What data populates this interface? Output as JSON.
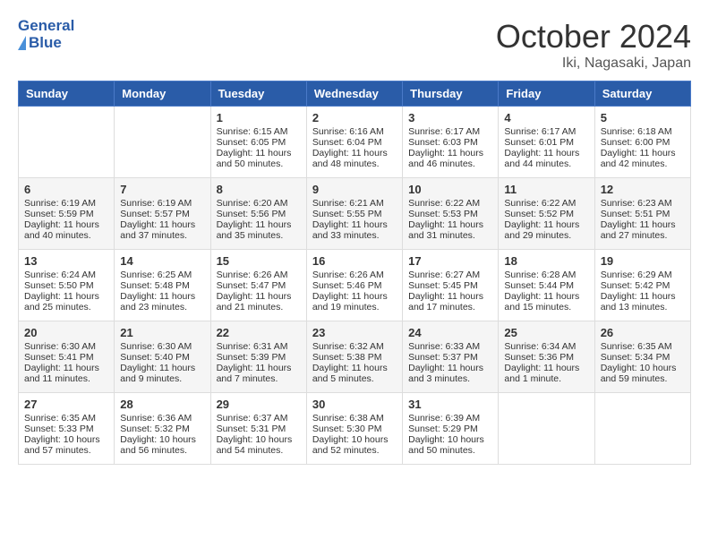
{
  "header": {
    "logo_general": "General",
    "logo_blue": "Blue",
    "month": "October 2024",
    "location": "Iki, Nagasaki, Japan"
  },
  "weekdays": [
    "Sunday",
    "Monday",
    "Tuesday",
    "Wednesday",
    "Thursday",
    "Friday",
    "Saturday"
  ],
  "weeks": [
    [
      {
        "day": "",
        "sunrise": "",
        "sunset": "",
        "daylight": ""
      },
      {
        "day": "",
        "sunrise": "",
        "sunset": "",
        "daylight": ""
      },
      {
        "day": "1",
        "sunrise": "Sunrise: 6:15 AM",
        "sunset": "Sunset: 6:05 PM",
        "daylight": "Daylight: 11 hours and 50 minutes."
      },
      {
        "day": "2",
        "sunrise": "Sunrise: 6:16 AM",
        "sunset": "Sunset: 6:04 PM",
        "daylight": "Daylight: 11 hours and 48 minutes."
      },
      {
        "day": "3",
        "sunrise": "Sunrise: 6:17 AM",
        "sunset": "Sunset: 6:03 PM",
        "daylight": "Daylight: 11 hours and 46 minutes."
      },
      {
        "day": "4",
        "sunrise": "Sunrise: 6:17 AM",
        "sunset": "Sunset: 6:01 PM",
        "daylight": "Daylight: 11 hours and 44 minutes."
      },
      {
        "day": "5",
        "sunrise": "Sunrise: 6:18 AM",
        "sunset": "Sunset: 6:00 PM",
        "daylight": "Daylight: 11 hours and 42 minutes."
      }
    ],
    [
      {
        "day": "6",
        "sunrise": "Sunrise: 6:19 AM",
        "sunset": "Sunset: 5:59 PM",
        "daylight": "Daylight: 11 hours and 40 minutes."
      },
      {
        "day": "7",
        "sunrise": "Sunrise: 6:19 AM",
        "sunset": "Sunset: 5:57 PM",
        "daylight": "Daylight: 11 hours and 37 minutes."
      },
      {
        "day": "8",
        "sunrise": "Sunrise: 6:20 AM",
        "sunset": "Sunset: 5:56 PM",
        "daylight": "Daylight: 11 hours and 35 minutes."
      },
      {
        "day": "9",
        "sunrise": "Sunrise: 6:21 AM",
        "sunset": "Sunset: 5:55 PM",
        "daylight": "Daylight: 11 hours and 33 minutes."
      },
      {
        "day": "10",
        "sunrise": "Sunrise: 6:22 AM",
        "sunset": "Sunset: 5:53 PM",
        "daylight": "Daylight: 11 hours and 31 minutes."
      },
      {
        "day": "11",
        "sunrise": "Sunrise: 6:22 AM",
        "sunset": "Sunset: 5:52 PM",
        "daylight": "Daylight: 11 hours and 29 minutes."
      },
      {
        "day": "12",
        "sunrise": "Sunrise: 6:23 AM",
        "sunset": "Sunset: 5:51 PM",
        "daylight": "Daylight: 11 hours and 27 minutes."
      }
    ],
    [
      {
        "day": "13",
        "sunrise": "Sunrise: 6:24 AM",
        "sunset": "Sunset: 5:50 PM",
        "daylight": "Daylight: 11 hours and 25 minutes."
      },
      {
        "day": "14",
        "sunrise": "Sunrise: 6:25 AM",
        "sunset": "Sunset: 5:48 PM",
        "daylight": "Daylight: 11 hours and 23 minutes."
      },
      {
        "day": "15",
        "sunrise": "Sunrise: 6:26 AM",
        "sunset": "Sunset: 5:47 PM",
        "daylight": "Daylight: 11 hours and 21 minutes."
      },
      {
        "day": "16",
        "sunrise": "Sunrise: 6:26 AM",
        "sunset": "Sunset: 5:46 PM",
        "daylight": "Daylight: 11 hours and 19 minutes."
      },
      {
        "day": "17",
        "sunrise": "Sunrise: 6:27 AM",
        "sunset": "Sunset: 5:45 PM",
        "daylight": "Daylight: 11 hours and 17 minutes."
      },
      {
        "day": "18",
        "sunrise": "Sunrise: 6:28 AM",
        "sunset": "Sunset: 5:44 PM",
        "daylight": "Daylight: 11 hours and 15 minutes."
      },
      {
        "day": "19",
        "sunrise": "Sunrise: 6:29 AM",
        "sunset": "Sunset: 5:42 PM",
        "daylight": "Daylight: 11 hours and 13 minutes."
      }
    ],
    [
      {
        "day": "20",
        "sunrise": "Sunrise: 6:30 AM",
        "sunset": "Sunset: 5:41 PM",
        "daylight": "Daylight: 11 hours and 11 minutes."
      },
      {
        "day": "21",
        "sunrise": "Sunrise: 6:30 AM",
        "sunset": "Sunset: 5:40 PM",
        "daylight": "Daylight: 11 hours and 9 minutes."
      },
      {
        "day": "22",
        "sunrise": "Sunrise: 6:31 AM",
        "sunset": "Sunset: 5:39 PM",
        "daylight": "Daylight: 11 hours and 7 minutes."
      },
      {
        "day": "23",
        "sunrise": "Sunrise: 6:32 AM",
        "sunset": "Sunset: 5:38 PM",
        "daylight": "Daylight: 11 hours and 5 minutes."
      },
      {
        "day": "24",
        "sunrise": "Sunrise: 6:33 AM",
        "sunset": "Sunset: 5:37 PM",
        "daylight": "Daylight: 11 hours and 3 minutes."
      },
      {
        "day": "25",
        "sunrise": "Sunrise: 6:34 AM",
        "sunset": "Sunset: 5:36 PM",
        "daylight": "Daylight: 11 hours and 1 minute."
      },
      {
        "day": "26",
        "sunrise": "Sunrise: 6:35 AM",
        "sunset": "Sunset: 5:34 PM",
        "daylight": "Daylight: 10 hours and 59 minutes."
      }
    ],
    [
      {
        "day": "27",
        "sunrise": "Sunrise: 6:35 AM",
        "sunset": "Sunset: 5:33 PM",
        "daylight": "Daylight: 10 hours and 57 minutes."
      },
      {
        "day": "28",
        "sunrise": "Sunrise: 6:36 AM",
        "sunset": "Sunset: 5:32 PM",
        "daylight": "Daylight: 10 hours and 56 minutes."
      },
      {
        "day": "29",
        "sunrise": "Sunrise: 6:37 AM",
        "sunset": "Sunset: 5:31 PM",
        "daylight": "Daylight: 10 hours and 54 minutes."
      },
      {
        "day": "30",
        "sunrise": "Sunrise: 6:38 AM",
        "sunset": "Sunset: 5:30 PM",
        "daylight": "Daylight: 10 hours and 52 minutes."
      },
      {
        "day": "31",
        "sunrise": "Sunrise: 6:39 AM",
        "sunset": "Sunset: 5:29 PM",
        "daylight": "Daylight: 10 hours and 50 minutes."
      },
      {
        "day": "",
        "sunrise": "",
        "sunset": "",
        "daylight": ""
      },
      {
        "day": "",
        "sunrise": "",
        "sunset": "",
        "daylight": ""
      }
    ]
  ]
}
